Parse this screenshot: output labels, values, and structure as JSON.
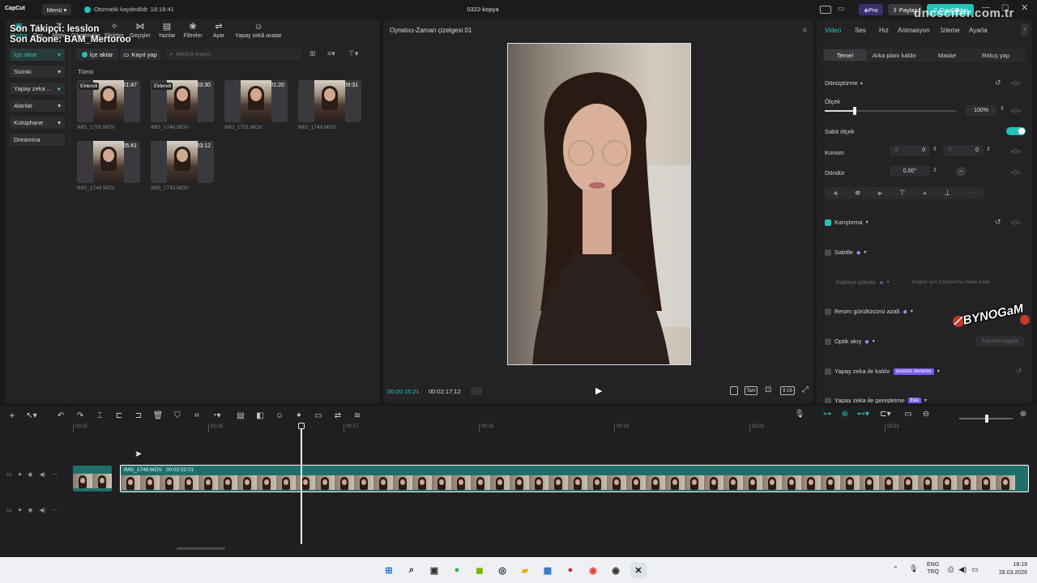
{
  "overlay": {
    "line1": "Son Takipçi: lession",
    "line2": "Son Abone: BAM_Mertoroo"
  },
  "watermark": "dncscifer.com.tr",
  "sticker": "BYNOGaM",
  "titlebar": {
    "app_name": "CapCut",
    "menu_label": "Menü",
    "autosave": "Otomatik kaydedildi: 18:18:41",
    "project_title": "0322-kopya",
    "pro_label": "Pro",
    "share_label": "Paylaş",
    "export_label": "Dışa Aktar"
  },
  "toolbar": {
    "items": [
      "Medya",
      "Ses",
      "Metin",
      "Çıkartmalar",
      "Efektler",
      "Geçişler",
      "Yazılar",
      "Filtreler",
      "Ayar",
      "Yapay zekâ avatar"
    ]
  },
  "media": {
    "import_label": "İçe aktar",
    "record_label": "Kayıt yap",
    "search_placeholder": "Medya arayın",
    "section": "Tümü",
    "side": [
      "İçe aktar",
      "Sizinki",
      "Yapay zeka ...",
      "Alanlar",
      "Kütüphane",
      "Dreamina"
    ],
    "clips": [
      {
        "name": "IMG_1750.MOV",
        "duration": "01:47",
        "tag": "Eklendi"
      },
      {
        "name": "IMG_1748.MOV",
        "duration": "03:30",
        "tag": "Eklendi"
      },
      {
        "name": "IMG_1751.MOV",
        "duration": "01:20",
        "tag": ""
      },
      {
        "name": "IMG_1749.MOV",
        "duration": "09:31",
        "tag": ""
      },
      {
        "name": "IMG_1746.MOV",
        "duration": "05:41",
        "tag": ""
      },
      {
        "name": "IMG_1743.MOV",
        "duration": "03:12",
        "tag": ""
      }
    ]
  },
  "player": {
    "title": "Oynatıcı-Zaman çizelgesi 01",
    "current": "00:00:16:21",
    "total": "00:02:17:12",
    "full_label": "Tam",
    "ratio_label": "9:16"
  },
  "inspector": {
    "tabs": [
      "Video",
      "Ses",
      "Hız",
      "Animasyon",
      "İzleme",
      "Ayarla"
    ],
    "subtabs": [
      "Temel",
      "Arka planı kaldır",
      "Maske",
      "Rötuş yap"
    ],
    "transform": "Dönüştürme",
    "scale_label": "Ölçek",
    "scale_value": "100%",
    "scale_fraction": 0.23,
    "uniform_scale": "Sabit ölçek",
    "position_label": "Konum",
    "pos_x_label": "X",
    "pos_x": "0",
    "pos_y_label": "Y",
    "pos_y": "0",
    "rotate_label": "Döndür",
    "rotate_value": "0.00°",
    "blend": "Karıştırma",
    "stabilize": "Sabitle",
    "enhance": "Kaliteyi iyileştir",
    "enhance_note": "Bugün için 3 kullanma hakkı kaldı",
    "denoise": "Resim gürültüsünü azalt",
    "optical": "Optik akış",
    "optical_btn": "Tümüne uygula",
    "ai_remove": "Yapay zeka ile kaldır",
    "ai_remove_badge": "ücretsiz deneme",
    "ai_expand": "Yapay zeka ile genişletme",
    "ai_expand_badge": "free"
  },
  "timeline": {
    "ruler": [
      "00:15",
      "00:16",
      "00:17",
      "00:18",
      "00:19",
      "00:20",
      "00:21"
    ],
    "clip_name": "IMG_1748.MOV",
    "clip_duration": "00:02:02:01"
  },
  "taskbar": {
    "lang1": "ENG",
    "lang2": "TRQ",
    "time": "18:19",
    "date": "28.03.2026"
  },
  "colors": {
    "accent": "#25c2b9",
    "pro": "#5a4bd6",
    "badge": "#7b5cf0"
  }
}
